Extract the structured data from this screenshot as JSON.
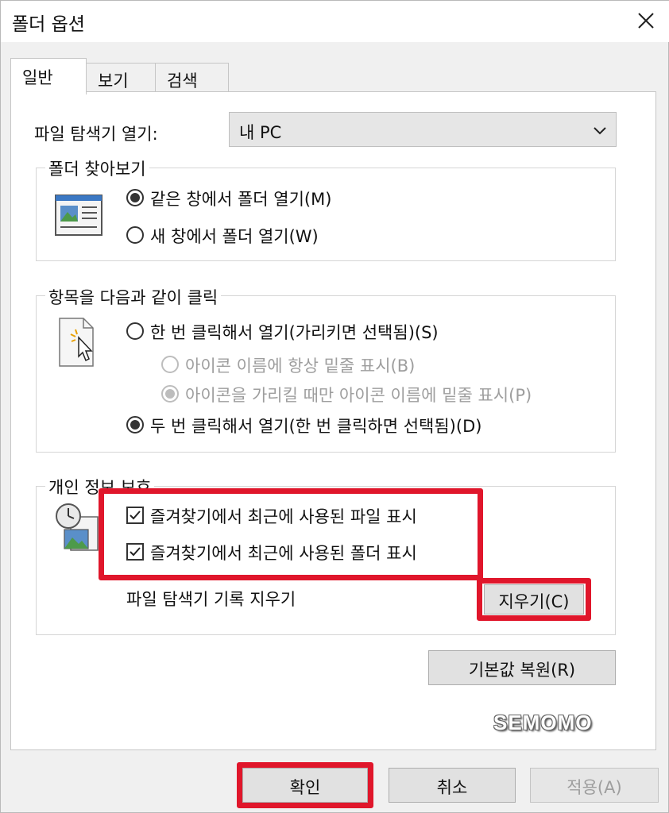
{
  "window": {
    "title": "폴더 옵션"
  },
  "tabs": [
    {
      "label": "일반",
      "active": true
    },
    {
      "label": "보기",
      "active": false
    },
    {
      "label": "검색",
      "active": false
    }
  ],
  "general": {
    "open_explorer_label": "파일 탐색기 열기:",
    "open_explorer_value": "내 PC",
    "browse_folders": {
      "title": "폴더 찾아보기",
      "options": [
        {
          "label": "같은 창에서 폴더 열기(M)",
          "checked": true
        },
        {
          "label": "새 창에서 폴더 열기(W)",
          "checked": false
        }
      ]
    },
    "click_items": {
      "title": "항목을 다음과 같이 클릭",
      "single_click": {
        "label": "한 번 클릭해서 열기(가리키면 선택됨)(S)",
        "checked": false
      },
      "underline_always": {
        "label": "아이콘 이름에 항상 밑줄 표시(B)",
        "checked": false,
        "enabled": false
      },
      "underline_hover": {
        "label": "아이콘을 가리킬 때만 아이콘 이름에 밑줄 표시(P)",
        "checked": true,
        "enabled": false
      },
      "double_click": {
        "label": "두 번 클릭해서 열기(한 번 클릭하면 선택됨)(D)",
        "checked": true
      }
    },
    "privacy": {
      "title": "개인 정보 보호",
      "show_recent_files": {
        "label": "즐겨찾기에서 최근에 사용된 파일 표시",
        "checked": true
      },
      "show_frequent_folders": {
        "label": "즐겨찾기에서 최근에 사용된 폴더 표시",
        "checked": true
      },
      "clear_history_label": "파일 탐색기 기록 지우기",
      "clear_button": "지우기(C)"
    },
    "restore_defaults_button": "기본값 복원(R)"
  },
  "footer": {
    "ok_button": "확인",
    "cancel_button": "취소",
    "apply_button": "적용(A)"
  },
  "watermark": "SEMOMO",
  "colors": {
    "highlight": "#e0162b"
  }
}
